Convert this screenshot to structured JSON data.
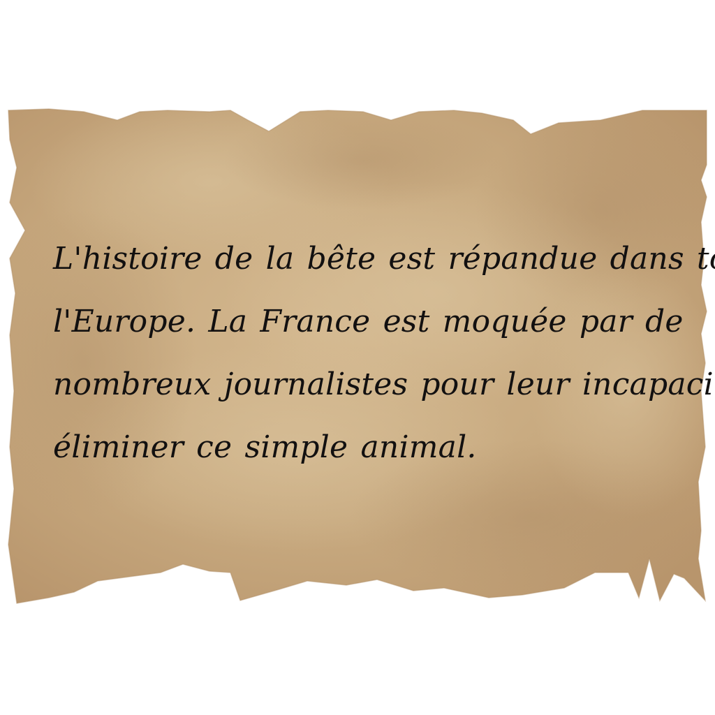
{
  "parchment": {
    "base_color": "#c8aa80",
    "light_color": "#d8c09a",
    "dark_color": "#b8946a",
    "ink_color": "#121010"
  },
  "letter": {
    "lines": [
      "L'histoire de la bête est répandue dans toute",
      "l'Europe. La France est moquée par de",
      "nombreux journalistes pour leur incapacité a",
      "éliminer ce simple animal."
    ]
  }
}
